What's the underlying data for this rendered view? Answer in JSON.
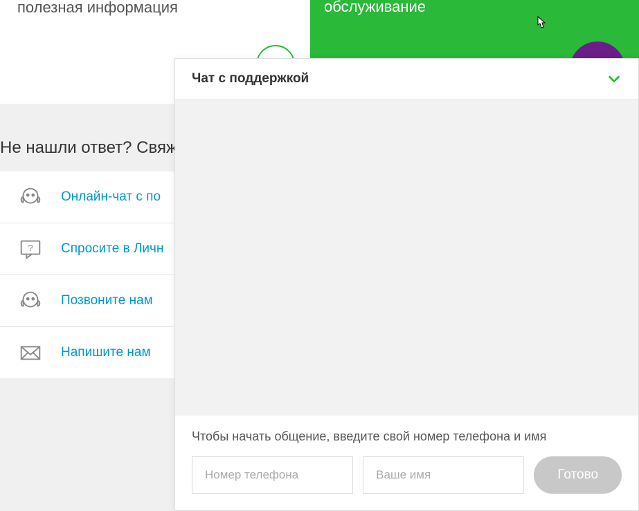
{
  "top": {
    "info_text": "полезная информация",
    "green_card_text": "обслуживание"
  },
  "contact": {
    "heading": "Не нашли ответ? Свяж",
    "items": [
      {
        "label": "Онлайн-чат с по"
      },
      {
        "label": "Спросите в Личн"
      },
      {
        "label": "Позвоните нам"
      },
      {
        "label": "Напишите нам"
      }
    ]
  },
  "chat": {
    "title": "Чат с поддержкой",
    "instruction": "Чтобы начать общение, введите свой номер телефона и имя",
    "phone_placeholder": "Номер телефона",
    "name_placeholder": "Ваше имя",
    "submit_label": "Готово"
  }
}
